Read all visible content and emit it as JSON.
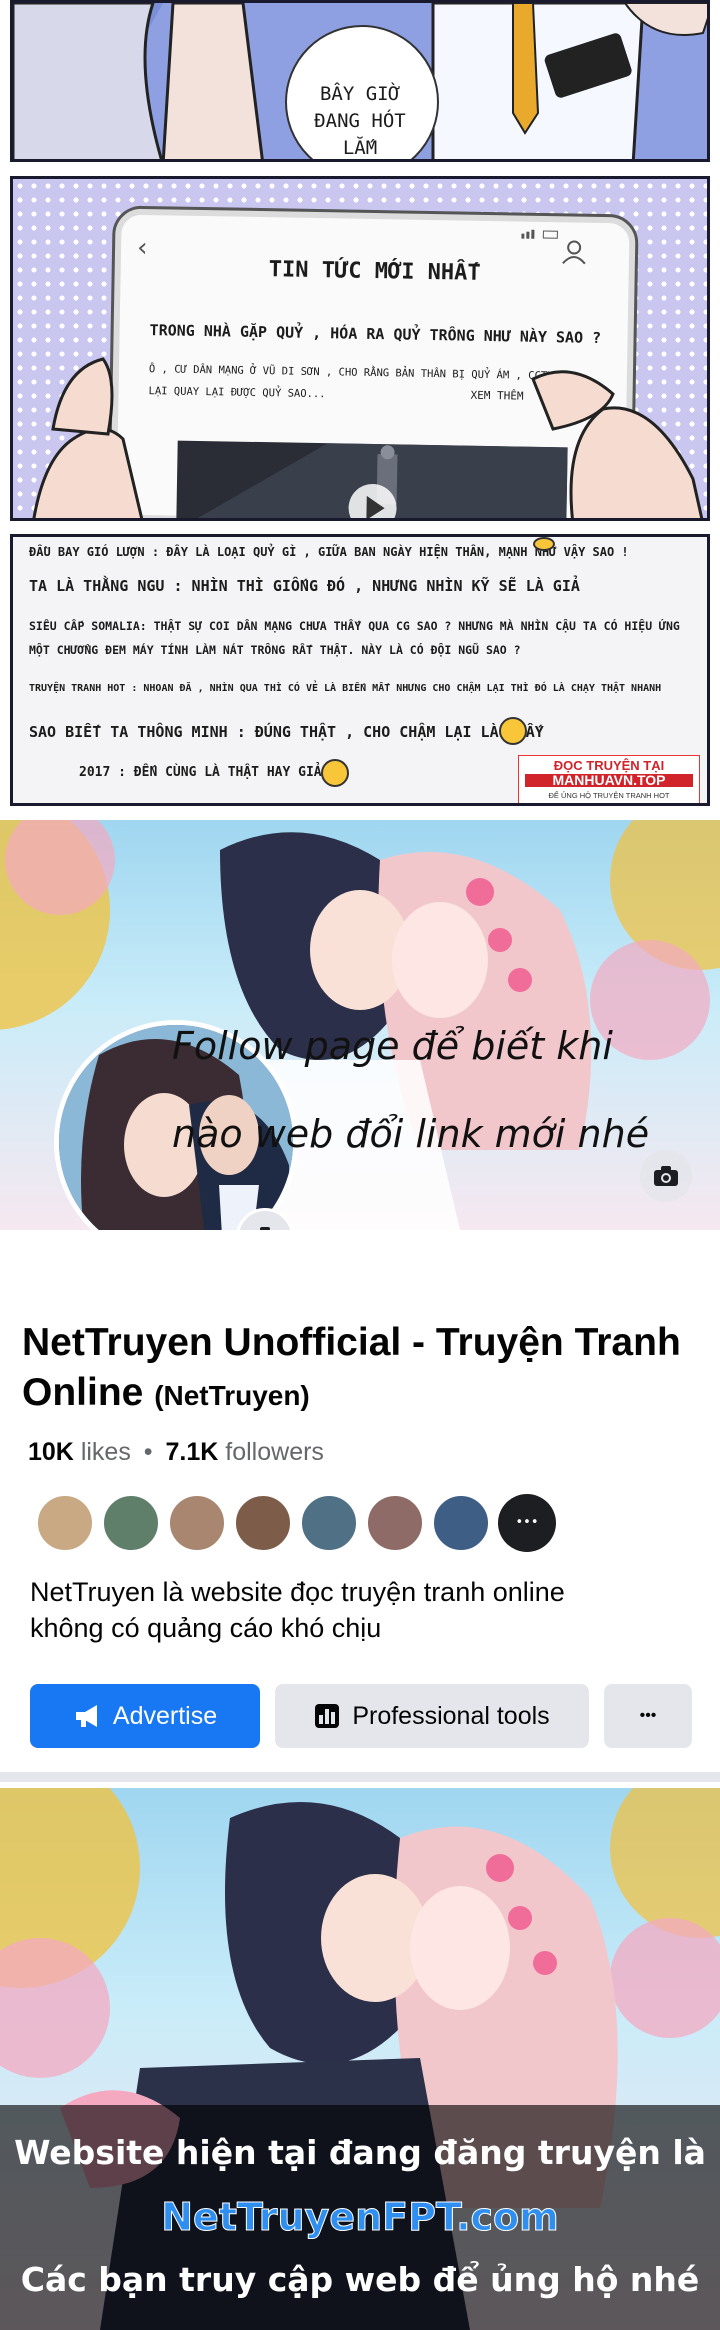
{
  "panel1": {
    "bubble": [
      "BÂY GIỜ",
      "ĐANG HÓT",
      "LẮM"
    ]
  },
  "panel2": {
    "phone_title": "TIN TỨC MỚI NHẤT",
    "headline": "TRONG NHÀ GẶP QUỶ , HÓA RA QUỶ TRÔNG NHƯ NÀY SAO ?",
    "body_line1": "Ô , CƯ DÂN MẠNG Ở VŨ DI SƠN , CHO RẰNG BẢN THÂN BỊ QUỶ ÁM , CCTV",
    "body_line2": "LẠI QUAY LẠI  ĐƯỢC QUỶ SAO...",
    "see_more": "XEM THÊM",
    "icons": [
      "back-icon",
      "user-icon",
      "play-icon"
    ]
  },
  "panel3": {
    "comments": [
      "ĐẦU BAY GIÓ LƯỢN : ĐÂY LÀ LOẠI QUỶ GÌ , GIỮA BAN NGÀY HIỆN THÂN, MẠNH NHƯ VẬY SAO !",
      "TA LÀ THẰNG NGU : NHÌN THÌ GIỐNG ĐÓ , NHƯNG NHÌN KỸ SẼ LÀ GIẢ",
      "SIÊU CẤP SOMALIA: THẬT SỰ COI DÂN MẠNG CHƯA THẤY QUA CG SAO ? NHƯNG MÀ NHÌN CẬU TA CÓ HIỆU ỨNG",
      "MỘT CHƯỞNG ĐEM MÁY TÍNH LÀM NÁT TRÔNG RẤT THẬT. NÀY LÀ CÓ ĐỘI NGŨ SAO ?",
      "TRUYỆN TRANH HOT : NHOAN ĐÃ , NHÌN QUA THÌ CÓ VẺ LÀ BIẾN MẤT NHƯNG CHO CHẬM LẠI THÌ ĐÓ LÀ CHẠY THẬT NHANH",
      "SAO BIẾT TA THÔNG MINH : ĐÚNG THẬT , CHO CHẬM LẠI LÀ THẤY",
      "2017 : ĐẾN CÙNG LÀ THẬT HAY GIẢ ?"
    ],
    "watermark": [
      "ĐỌC TRUYỆN TẠI",
      "MANHUAVN.TOP",
      "ĐỂ ỦNG HỘ TRUYỆN TRANH HOT"
    ]
  },
  "banner": {
    "overlay_line1": "Follow page để biết khi",
    "overlay_line2": "nào web đổi link mới nhé"
  },
  "profile": {
    "name_main": "NetTruyen Unofficial - Truyện Tranh Online",
    "name_sub": "(NetTruyen)",
    "likes_count": "10K",
    "likes_label": "likes",
    "bullet": "•",
    "followers_count": "7.1K",
    "followers_label": "followers",
    "follower_more": "•••",
    "description_line1": "NetTruyen là website đọc truyện tranh online",
    "description_line2": "không có quảng cáo khó chịu",
    "advertise_label": "Advertise",
    "pro_tools_label": "Professional tools",
    "more_label": "•••",
    "accent": "#1877f2"
  },
  "footer": {
    "line1": "Website hiện tại đang đăng truyện là",
    "domain": "NetTruyenFPT.com",
    "line3": "Các bạn truy cập web để ủng hộ nhé",
    "domain_color": "#2f8ff0"
  }
}
